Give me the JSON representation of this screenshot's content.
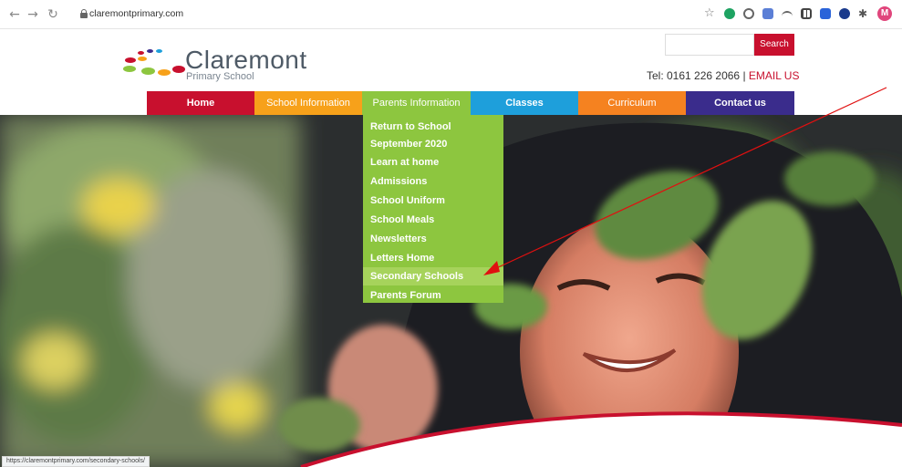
{
  "browser": {
    "url": "claremontprimary.com",
    "profile_initial": "M",
    "status_url": "https://claremontprimary.com/secondary-schools/",
    "icons": [
      "back-icon",
      "forward-icon",
      "reload-icon",
      "lock-icon",
      "star-icon",
      "avatar"
    ]
  },
  "site": {
    "logo_title": "Claremont",
    "logo_subtitle": "Primary School",
    "search_placeholder": "",
    "search_button": "Search",
    "tel_label": "Tel: 0161 226 2066",
    "separator": "|",
    "email_label": "EMAIL US",
    "accent_color": "#c8102e"
  },
  "menu": {
    "items": [
      {
        "label": "Home",
        "color": "#c8102e"
      },
      {
        "label": "School Information",
        "color": "#f7a11a"
      },
      {
        "label": "Parents Information",
        "color": "#8dc63f"
      },
      {
        "label": "Classes",
        "color": "#1e9fdb"
      },
      {
        "label": "Curriculum",
        "color": "#f58220"
      },
      {
        "label": "Contact us",
        "color": "#3a2c8c"
      }
    ]
  },
  "dropdown": {
    "items": [
      "Return to School September 2020",
      "Learn at home",
      "Admissions",
      "School Uniform",
      "School Meals",
      "Newsletters",
      "Letters Home",
      "Secondary Schools",
      "Parents Forum"
    ],
    "highlighted": "Secondary Schools"
  }
}
